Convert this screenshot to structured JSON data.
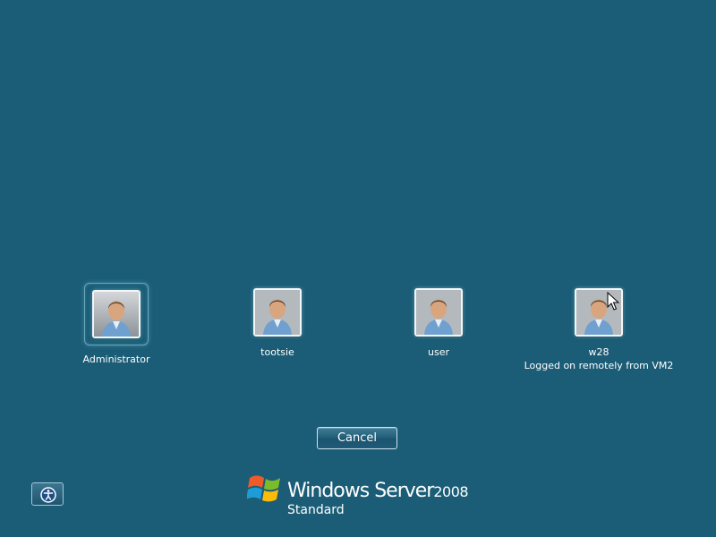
{
  "users": [
    {
      "name": "Administrator",
      "status": "",
      "selected": true
    },
    {
      "name": "tootsie",
      "status": "",
      "selected": false
    },
    {
      "name": "user",
      "status": "",
      "selected": false
    },
    {
      "name": "w28",
      "status": "Logged on remotely from VM2",
      "selected": false
    }
  ],
  "cancel_label": "Cancel",
  "ease_of_access_icon": "ease-of-access-icon",
  "brand": {
    "logo_icon": "windows-flag-icon",
    "product": "Windows Server",
    "version": "2008",
    "edition": "Standard"
  },
  "colors": {
    "background": "#1b5c76",
    "button_border": "#cfe3ec",
    "tile_glow": "#8cdceb"
  }
}
